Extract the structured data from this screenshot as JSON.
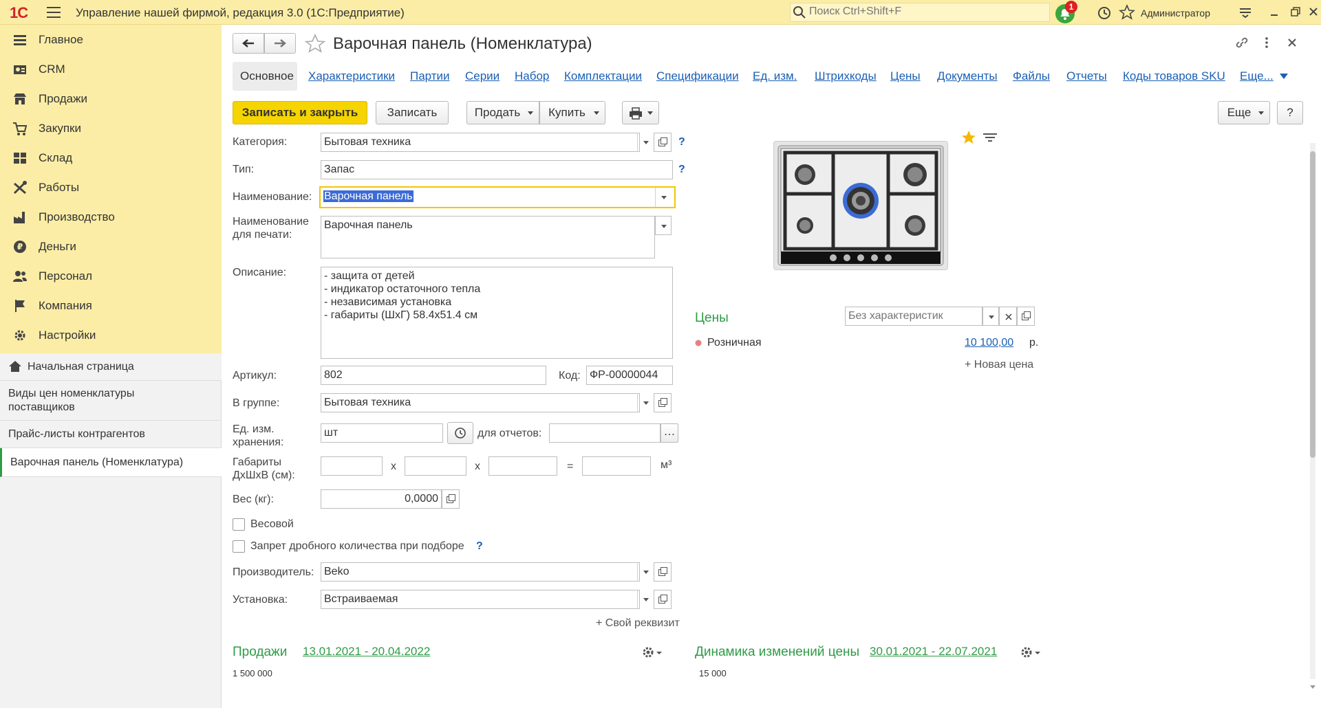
{
  "app": {
    "logo": "1С",
    "title": "Управление нашей фирмой, редакция 3.0  (1С:Предприятие)",
    "search_placeholder": "Поиск Ctrl+Shift+F",
    "notifications_count": "1",
    "user": "Администратор"
  },
  "sidebar": {
    "sections": [
      {
        "label": "Главное",
        "icon": "menu-lines-icon"
      },
      {
        "label": "CRM",
        "icon": "contact-card-icon"
      },
      {
        "label": "Продажи",
        "icon": "shop-icon"
      },
      {
        "label": "Закупки",
        "icon": "cart-icon"
      },
      {
        "label": "Склад",
        "icon": "warehouse-grid-icon"
      },
      {
        "label": "Работы",
        "icon": "tools-icon"
      },
      {
        "label": "Производство",
        "icon": "factory-icon"
      },
      {
        "label": "Деньги",
        "icon": "ruble-coin-icon"
      },
      {
        "label": "Персонал",
        "icon": "people-icon"
      },
      {
        "label": "Компания",
        "icon": "flag-icon"
      },
      {
        "label": "Настройки",
        "icon": "gear-icon"
      }
    ],
    "home": "Начальная страница",
    "open_windows": [
      "Виды цен номенклатуры поставщиков",
      "Прайс-листы контрагентов",
      "Варочная панель (Номенклатура)"
    ]
  },
  "form": {
    "title": "Варочная панель (Номенклатура)",
    "tabs": [
      "Основное",
      "Характеристики",
      "Партии",
      "Серии",
      "Набор",
      "Комплектации",
      "Спецификации",
      "Ед. изм.",
      "Штрихкоды",
      "Цены",
      "Документы",
      "Файлы",
      "Отчеты",
      "Коды товаров SKU",
      "Еще..."
    ],
    "toolbar": {
      "save_close": "Записать и закрыть",
      "save": "Записать",
      "sell": "Продать",
      "buy": "Купить",
      "more": "Еще",
      "help": "?"
    },
    "fields": {
      "category_label": "Категория:",
      "category": "Бытовая техника",
      "type_label": "Тип:",
      "type": "Запас",
      "name_label": "Наименование:",
      "name": "Варочная панель",
      "print_name_label_1": "Наименование",
      "print_name_label_2": "для печати:",
      "print_name": "Варочная панель",
      "description_label": "Описание:",
      "description": [
        "- защита от детей",
        "- индикатор остаточного тепла",
        "- независимая установка",
        "- габариты (ШхГ) 58.4х51.4 см"
      ],
      "article_label": "Артикул:",
      "article": "802",
      "code_label": "Код:",
      "code": "ФР-00000044",
      "group_label": "В группе:",
      "group": "Бытовая техника",
      "unit_label_1": "Ед. изм.",
      "unit_label_2": "хранения:",
      "unit": "шт",
      "reports_label": "для отчетов:",
      "dims_label_1": "Габариты",
      "dims_label_2": "ДхШхВ (см):",
      "x": "х",
      "eq": "=",
      "m3": "м³",
      "weight_label": "Вес (кг):",
      "weight": "0,0000",
      "weighted_label": "Весовой",
      "fraction_label": "Запрет дробного количества при подборе",
      "manufacturer_label": "Производитель:",
      "manufacturer": "Beko",
      "install_label": "Установка:",
      "install": "Встраиваемая",
      "own_attr": "+ Свой реквизит",
      "help_q": "?"
    },
    "prices": {
      "title": "Цены",
      "char_placeholder": "Без характеристик",
      "retail_label": "Розничная",
      "retail_value": "10 100,00",
      "currency": "р.",
      "new_price": "+ Новая цена"
    },
    "sales": {
      "title": "Продажи",
      "period": "13.01.2021 - 20.04.2022",
      "axis_top": "1 500 000"
    },
    "price_dynamics": {
      "title": "Динамика изменений цены",
      "period": "30.01.2021 - 22.07.2021",
      "axis_top": "15 000"
    }
  },
  "colors": {
    "topbar": "#fbeda6",
    "accent_yellow": "#f5d400",
    "link_blue": "#1a5fb4",
    "green": "#2f9b46"
  }
}
